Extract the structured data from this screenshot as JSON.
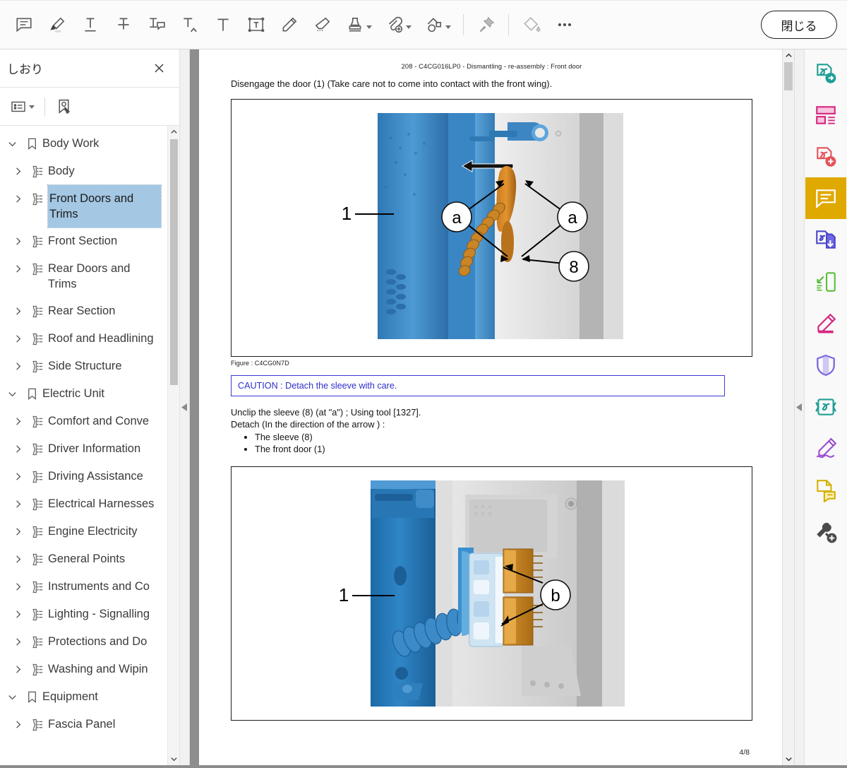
{
  "toolbar": {
    "tools": [
      {
        "name": "sticky-note-icon",
        "title": "Note"
      },
      {
        "name": "highlight-icon",
        "title": "Highlight"
      },
      {
        "name": "underline-icon",
        "title": "Underline"
      },
      {
        "name": "strikethrough-icon",
        "title": "Strikethrough"
      },
      {
        "name": "text-comment-icon",
        "title": "Text comment"
      },
      {
        "name": "text-insert-caret-icon",
        "title": "Insert text"
      },
      {
        "name": "text-tool-icon",
        "title": "Text"
      },
      {
        "name": "text-box-icon",
        "title": "Text box"
      },
      {
        "name": "pencil-icon",
        "title": "Pencil"
      },
      {
        "name": "eraser-icon",
        "title": "Eraser"
      },
      {
        "name": "stamp-icon",
        "title": "Stamp",
        "caret": true
      },
      {
        "name": "attachment-add-icon",
        "title": "Attach file",
        "caret": true
      },
      {
        "name": "shapes-icon",
        "title": "Shapes",
        "caret": true
      },
      {
        "name": "pin-icon",
        "title": "Pin"
      },
      {
        "name": "fill-color-icon",
        "title": "Fill color"
      },
      {
        "name": "more-options-icon",
        "title": "More"
      }
    ],
    "close_label": "閉じる"
  },
  "sidebar": {
    "title": "しおり",
    "close_icon": "close-icon",
    "panel_tools": [
      {
        "name": "list-options-icon",
        "caret": true
      },
      {
        "name": "add-bookmark-icon",
        "caret": false
      }
    ],
    "tree": [
      {
        "label": "Body Work",
        "level": 0,
        "icon": "bookmark-icon",
        "expanded": true,
        "selected": false,
        "wrap": false
      },
      {
        "label": "Body",
        "level": 1,
        "icon": "bookmark-node-icon",
        "expanded": false,
        "selected": false,
        "wrap": false
      },
      {
        "label": "Front Doors and Trims",
        "level": 1,
        "icon": "bookmark-node-icon",
        "expanded": false,
        "selected": true,
        "wrap": true
      },
      {
        "label": "Front Section",
        "level": 1,
        "icon": "bookmark-node-icon",
        "expanded": false,
        "selected": false,
        "wrap": false
      },
      {
        "label": "Rear Doors and Trims",
        "level": 1,
        "icon": "bookmark-node-icon",
        "expanded": false,
        "selected": false,
        "wrap": true
      },
      {
        "label": "Rear Section",
        "level": 1,
        "icon": "bookmark-node-icon",
        "expanded": false,
        "selected": false,
        "wrap": false
      },
      {
        "label": "Roof and Headlining",
        "level": 1,
        "icon": "bookmark-node-icon",
        "expanded": false,
        "selected": false,
        "wrap": true
      },
      {
        "label": "Side Structure",
        "level": 1,
        "icon": "bookmark-node-icon",
        "expanded": false,
        "selected": false,
        "wrap": false
      },
      {
        "label": "Electric Unit",
        "level": 0,
        "icon": "bookmark-icon",
        "expanded": true,
        "selected": false,
        "wrap": false
      },
      {
        "label": "Comfort and Conve",
        "level": 1,
        "icon": "bookmark-node-icon",
        "expanded": false,
        "selected": false,
        "wrap": false
      },
      {
        "label": "Driver Information",
        "level": 1,
        "icon": "bookmark-node-icon",
        "expanded": false,
        "selected": false,
        "wrap": false
      },
      {
        "label": "Driving Assistance",
        "level": 1,
        "icon": "bookmark-node-icon",
        "expanded": false,
        "selected": false,
        "wrap": false
      },
      {
        "label": "Electrical Harnesses",
        "level": 1,
        "icon": "bookmark-node-icon",
        "expanded": false,
        "selected": false,
        "wrap": false
      },
      {
        "label": "Engine Electricity",
        "level": 1,
        "icon": "bookmark-node-icon",
        "expanded": false,
        "selected": false,
        "wrap": false
      },
      {
        "label": "General Points",
        "level": 1,
        "icon": "bookmark-node-icon",
        "expanded": false,
        "selected": false,
        "wrap": false
      },
      {
        "label": "Instruments and Co",
        "level": 1,
        "icon": "bookmark-node-icon",
        "expanded": false,
        "selected": false,
        "wrap": false
      },
      {
        "label": "Lighting - Signalling",
        "level": 1,
        "icon": "bookmark-node-icon",
        "expanded": false,
        "selected": false,
        "wrap": false
      },
      {
        "label": "Protections and Do",
        "level": 1,
        "icon": "bookmark-node-icon",
        "expanded": false,
        "selected": false,
        "wrap": false
      },
      {
        "label": "Washing and Wipin",
        "level": 1,
        "icon": "bookmark-node-icon",
        "expanded": false,
        "selected": false,
        "wrap": false
      },
      {
        "label": "Equipment",
        "level": 0,
        "icon": "bookmark-icon",
        "expanded": true,
        "selected": false,
        "wrap": false
      },
      {
        "label": "Fascia Panel",
        "level": 1,
        "icon": "bookmark-node-icon",
        "expanded": false,
        "selected": false,
        "wrap": false
      }
    ]
  },
  "document": {
    "header": "208 - C4CG016LP0 - Dismantling - re-assembly : Front door",
    "intro": "Disengage the door (1) (Take care not to come into contact with the front wing).",
    "figure1": {
      "caption": "Figure : C4CG0N7D",
      "callouts": [
        "1",
        "a",
        "a",
        "8"
      ]
    },
    "caution": "CAUTION : Detach the sleeve with care.",
    "steps": [
      "Unclip the sleeve (8) (at \"a\") ; Using tool [1327].",
      "Detach (In the direction of the arrow ) :"
    ],
    "bullets": [
      "The sleeve (8)",
      "The front door (1)"
    ],
    "figure2": {
      "callouts": [
        "1",
        "b"
      ]
    },
    "page_number": "4/8"
  },
  "right_rail": {
    "items": [
      {
        "name": "export-pdf-icon",
        "color": "#1f9e96",
        "active": false
      },
      {
        "name": "organize-pages-icon",
        "color": "#d6277f",
        "active": false
      },
      {
        "name": "create-pdf-icon",
        "color": "#e4535a",
        "active": false
      },
      {
        "name": "comment-icon",
        "color": "#ffffff",
        "active": true
      },
      {
        "name": "combine-files-icon",
        "color": "#4b45c8",
        "active": false
      },
      {
        "name": "compress-pdf-icon",
        "color": "#5bbf3c",
        "active": false
      },
      {
        "name": "edit-pdf-icon",
        "color": "#d6277f",
        "active": false
      },
      {
        "name": "protect-icon",
        "color": "#7b6be0",
        "active": false
      },
      {
        "name": "redact-icon",
        "color": "#1f9e96",
        "active": false
      },
      {
        "name": "fill-sign-icon",
        "color": "#9b4fd1",
        "active": false
      },
      {
        "name": "request-signature-icon",
        "color": "#d4b106",
        "active": false
      },
      {
        "name": "more-tools-icon",
        "color": "#4a4a4a",
        "active": false
      }
    ],
    "active_color": "#dfa900"
  },
  "scrollbars": {
    "sidebar": {
      "up": "chevron-up-icon",
      "down": "chevron-down-icon"
    },
    "document": {
      "up": "chevron-up-icon",
      "down": "chevron-down-icon"
    }
  },
  "handles": {
    "left": "collapse-left-icon",
    "right": "collapse-right-icon"
  }
}
